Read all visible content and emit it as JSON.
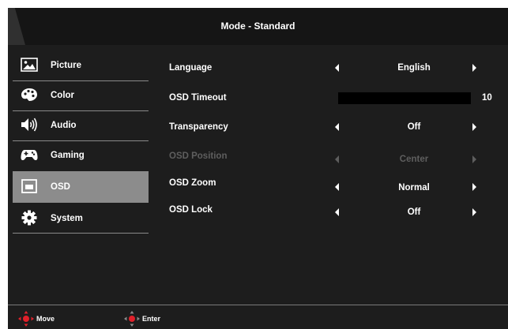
{
  "header": {
    "title": "Mode - Standard"
  },
  "sidebar": {
    "items": [
      {
        "label": "Picture",
        "icon": "picture-icon"
      },
      {
        "label": "Color",
        "icon": "palette-icon"
      },
      {
        "label": "Audio",
        "icon": "speaker-icon"
      },
      {
        "label": "Gaming",
        "icon": "gamepad-icon"
      },
      {
        "label": "OSD",
        "icon": "osd-window-icon",
        "active": true
      },
      {
        "label": "System",
        "icon": "gear-icon"
      }
    ]
  },
  "settings": {
    "language": {
      "label": "Language",
      "value": "English"
    },
    "osd_timeout": {
      "label": "OSD Timeout",
      "value": "10",
      "level_fraction": 1.0
    },
    "transparency": {
      "label": "Transparency",
      "value": "Off"
    },
    "osd_position": {
      "label": "OSD Position",
      "value": "Center",
      "disabled": true
    },
    "osd_zoom": {
      "label": "OSD Zoom",
      "value": "Normal"
    },
    "osd_lock": {
      "label": "OSD Lock",
      "value": "Off"
    }
  },
  "footer": {
    "move_label": "Move",
    "enter_label": "Enter"
  },
  "colors": {
    "background": "#1d1d1d",
    "header": "#151515",
    "active_item": "#8c8c8c",
    "dpad_center": "#e0202a",
    "disabled_text": "#5e5e5e"
  }
}
